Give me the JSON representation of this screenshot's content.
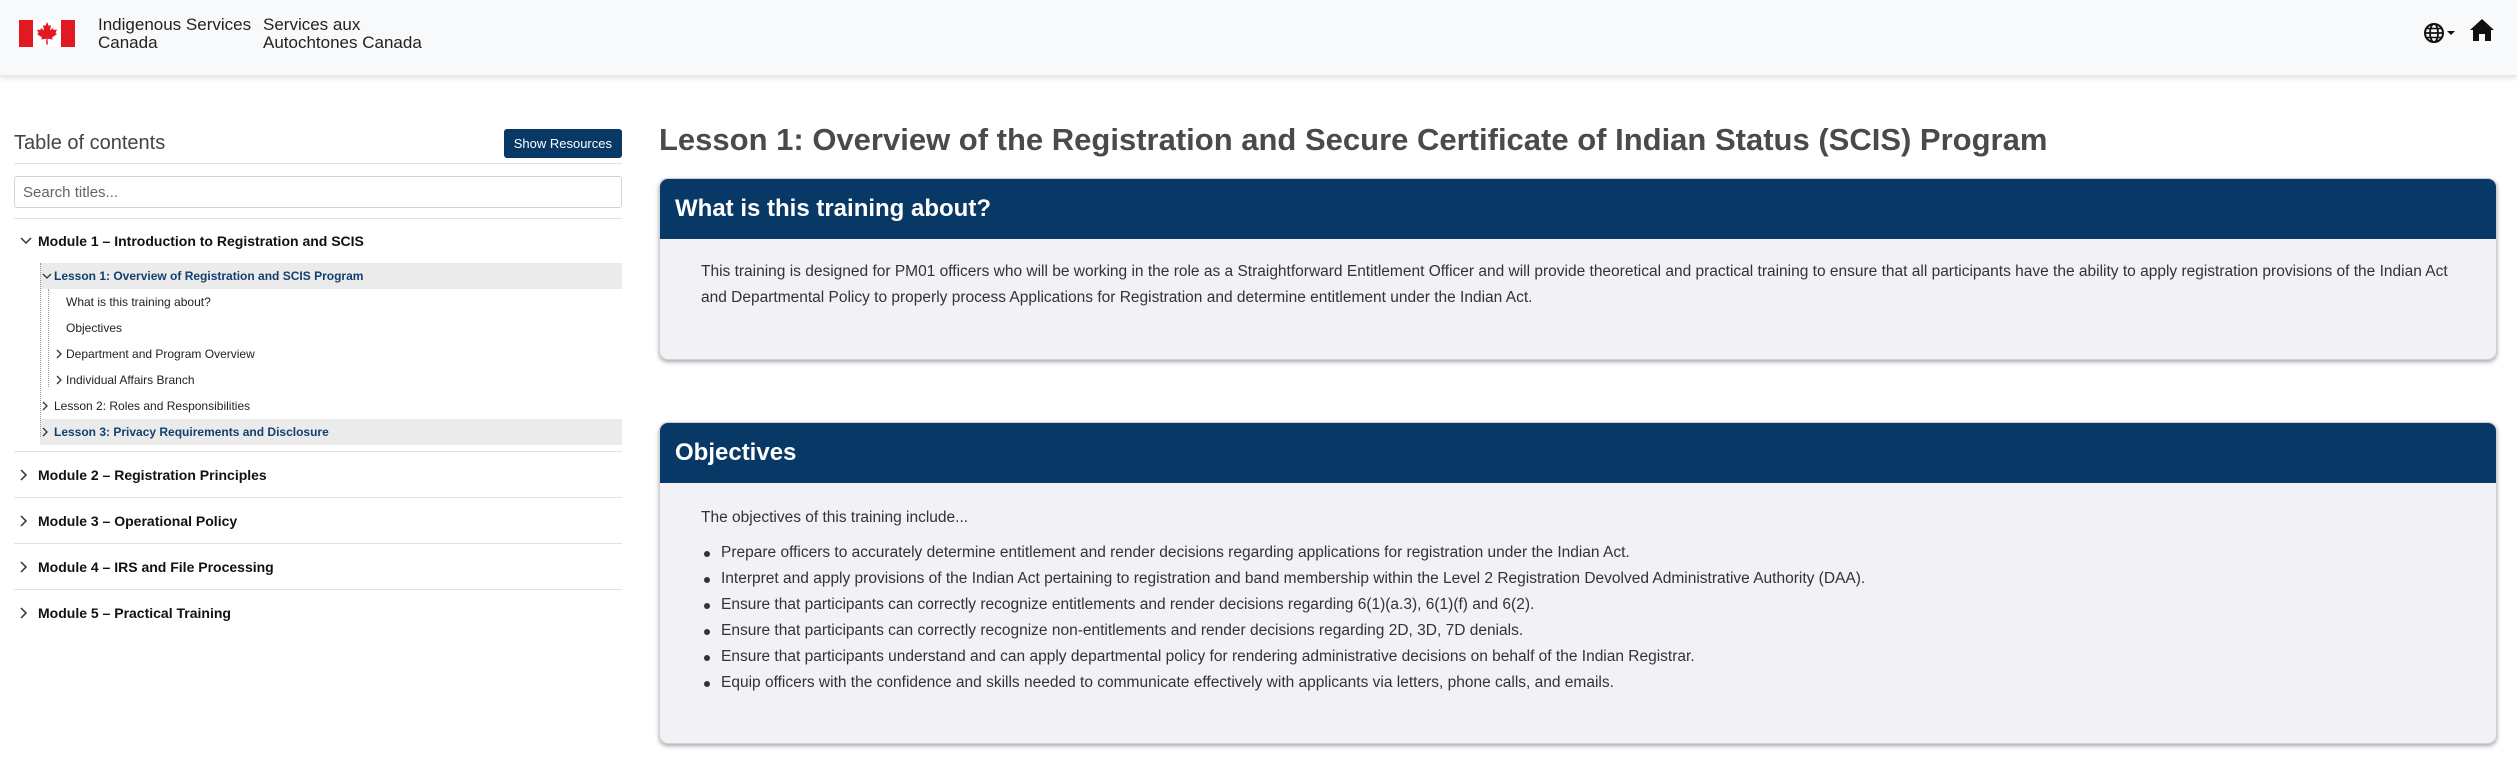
{
  "header": {
    "dept_en_line1": "Indigenous Services",
    "dept_en_line2": "Canada",
    "dept_fr_line1": "Services aux",
    "dept_fr_line2": "Autochtones Canada",
    "language_icon": "globe-icon",
    "home_icon": "home-icon",
    "brand_red": "#e11a22"
  },
  "sidebar": {
    "title": "Table of contents",
    "resources_button": "Show Resources",
    "search_placeholder": "Search titles...",
    "modules": [
      {
        "label": "Module 1 – Introduction to Registration and SCIS",
        "expanded": true,
        "lessons": [
          {
            "label": "Lesson 1: Overview of Registration and SCIS Program",
            "active": true,
            "expanded": true,
            "sections": [
              {
                "label": "What is this training about?",
                "has_children": false
              },
              {
                "label": "Objectives",
                "has_children": false
              },
              {
                "label": "Department and Program Overview",
                "has_children": true
              },
              {
                "label": "Individual Affairs Branch",
                "has_children": true
              }
            ]
          },
          {
            "label": "Lesson 2: Roles and Responsibilities",
            "active": false
          },
          {
            "label": "Lesson 3: Privacy Requirements and Disclosure",
            "active": true
          }
        ]
      },
      {
        "label": "Module 2 – Registration Principles"
      },
      {
        "label": "Module 3 – Operational Policy"
      },
      {
        "label": "Module 4 – IRS and File Processing"
      },
      {
        "label": "Module 5 – Practical Training"
      }
    ]
  },
  "main": {
    "lesson_title": "Lesson 1: Overview of the Registration and Secure Certificate of Indian Status (SCIS) Program",
    "about": {
      "heading": "What is this training about?",
      "body": "This training is designed for PM01 officers who will be working in the role as a Straightforward Entitlement Officer and will provide theoretical and practical training to ensure that all participants have the ability to apply registration provisions of the Indian Act and Departmental Policy to properly process Applications for Registration and determine entitlement under the Indian Act."
    },
    "objectives": {
      "heading": "Objectives",
      "intro": "The objectives of this training include...",
      "items": [
        "Prepare officers to accurately determine entitlement and render decisions regarding applications for registration under the Indian Act.",
        "Interpret and apply provisions of the Indian Act pertaining to registration and band membership within the Level 2 Registration Devolved Administrative Authority (DAA).",
        "Ensure that participants can correctly recognize entitlements and render decisions regarding 6(1)(a.3), 6(1)(f) and 6(2).",
        "Ensure that participants can correctly recognize non-entitlements and render decisions regarding 2D, 3D, 7D denials.",
        "Ensure that participants understand and can apply departmental policy for rendering administrative decisions on behalf of the Indian Registrar.",
        "Equip officers with the confidence and skills needed to communicate effectively with applicants via letters, phone calls, and emails."
      ]
    },
    "accent_color": "#083865"
  }
}
